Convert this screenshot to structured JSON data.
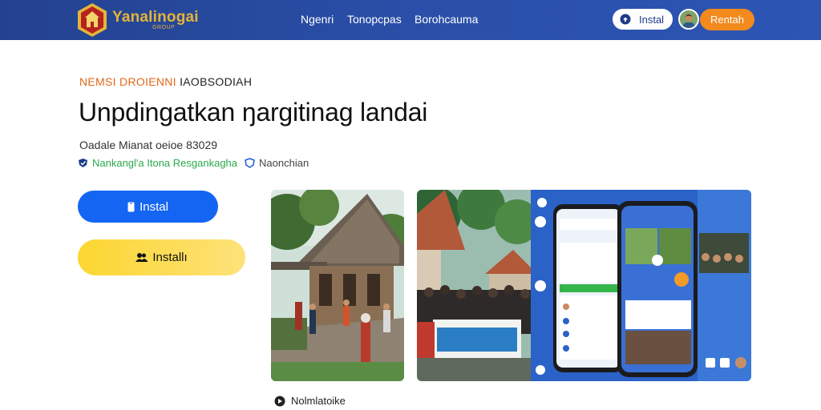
{
  "header": {
    "brand": "Yanalinogai",
    "brand_sub": "GROUP",
    "nav": [
      "Ngenri",
      "Tonopcpas",
      "Borohcauma"
    ],
    "install_label": "Instal",
    "cta_label": "Rentah"
  },
  "hero": {
    "eyebrow_a": "NEMSI DROIENNI",
    "eyebrow_b": "IAOBSODIAH",
    "title": "Unpdingatkan ŋargitinag landai",
    "subline": "Oadale Mianat oeioe 83029",
    "tag_green": "Nankangl'a Itona Resgankagha",
    "tag_gray": "Naonchian"
  },
  "buttons": {
    "primary": "Instal",
    "secondary": "Installı"
  },
  "footer_note": "Nolmlatoike",
  "colors": {
    "header_bg": "#2a4fa8",
    "brand_gold": "#e3b43a",
    "accent_orange": "#f28a1e",
    "primary_blue": "#1565f3",
    "yellow": "#fcd631",
    "eyebrow_orange": "#e2681a",
    "tag_green": "#2aa94a"
  },
  "icons": {
    "logo": "shield-house-icon",
    "install": "download-cloud-icon",
    "tag_a": "check-shield-icon",
    "tag_b": "heart-shield-icon",
    "primary_btn": "phone-icon",
    "secondary_btn": "users-icon",
    "footer": "info-icon"
  }
}
